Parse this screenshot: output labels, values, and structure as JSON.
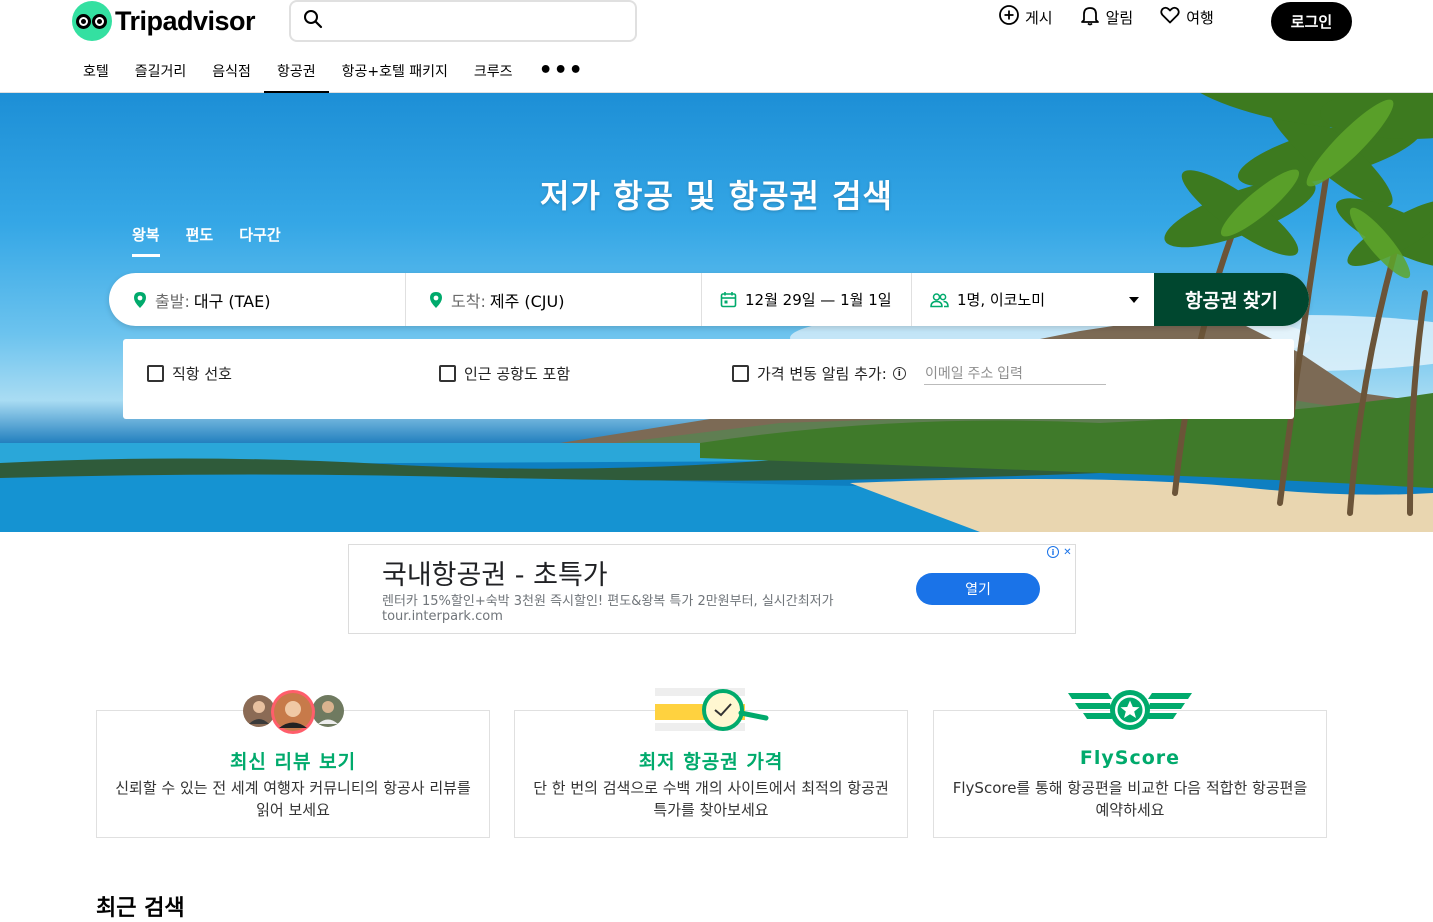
{
  "header": {
    "logo_text": "Tripadvisor",
    "search": {
      "placeholder": ""
    },
    "actions": [
      {
        "label": "게시",
        "icon": "plus-circle-icon"
      },
      {
        "label": "알림",
        "icon": "bell-icon"
      },
      {
        "label": "여행",
        "icon": "heart-icon"
      }
    ],
    "login_label": "로그인"
  },
  "nav": {
    "items": [
      "호텔",
      "즐길거리",
      "음식점",
      "항공권",
      "항공+호텔 패키지",
      "크루즈"
    ],
    "active": "항공권",
    "more_label": "•••"
  },
  "hero": {
    "title": "저가 항공 및 항공권 검색",
    "trip_tabs": [
      "왕복",
      "편도",
      "다구간"
    ],
    "active_tab": "왕복",
    "from": {
      "label": "출발:",
      "value": "대구 (TAE)"
    },
    "to": {
      "label": "도착:",
      "value": "제주 (CJU)"
    },
    "dates": "12월 29일 — 1월 1일",
    "passengers": "1명, 이코노미",
    "search_button": "항공권 찾기",
    "options": {
      "direct": "직항 선호",
      "nearby": "인근 공항도 포함",
      "price_alert": "가격 변동 알림 추가:",
      "info_icon": "ⓘ",
      "email_placeholder": "이메일 주소 입력"
    }
  },
  "ad": {
    "title": "국내항공권 - 초특가",
    "description": "렌터카 15%할인+숙박 3천원 즉시할인! 편도&왕복 특가 2만원부터, 실시간최저가",
    "url": "tour.interpark.com",
    "button": "열기",
    "info_badge": "i",
    "close_badge": "✕"
  },
  "features": [
    {
      "title": "최신 리뷰 보기",
      "description": "신뢰할 수 있는 전 세계 여행자 커뮤니티의 항공사 리뷰를 읽어 보세요"
    },
    {
      "title": "최저 항공권 가격",
      "description": "단 한 번의 검색으로 수백 개의 사이트에서 최적의 항공권 특가를 찾아보세요"
    },
    {
      "title": "FlyScore",
      "description": "FlyScore를 통해 항공편을 비교한 다음 적합한 항공편을 예약하세요"
    }
  ],
  "recent_searches_heading": "최근 검색",
  "colors": {
    "brand_green": "#34e0a1",
    "dark_green": "#00472f",
    "accent_green": "#00aa6c",
    "ad_blue": "#1a73e8"
  }
}
